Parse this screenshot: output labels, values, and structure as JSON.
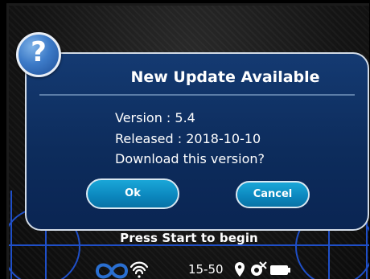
{
  "dialog": {
    "title": "New Update Available",
    "version_line": "Version : 5.4",
    "released_line": "Released : 2018-10-10",
    "question": "Download this version?",
    "ok_label": "Ok",
    "cancel_label": "Cancel",
    "icon": "question-icon",
    "icon_glyph": "?"
  },
  "background": {
    "prompt": "Press Start to begin"
  },
  "status_bar": {
    "time": "15-50",
    "icons": [
      "infinity-icon",
      "wifi-icon",
      "location-pin-icon",
      "gps-off-icon",
      "battery-icon"
    ]
  },
  "colors": {
    "dialog_fill": "#0d2c5c",
    "button_fill": "#0b86bd",
    "accent_blue": "#2a6fd1"
  }
}
